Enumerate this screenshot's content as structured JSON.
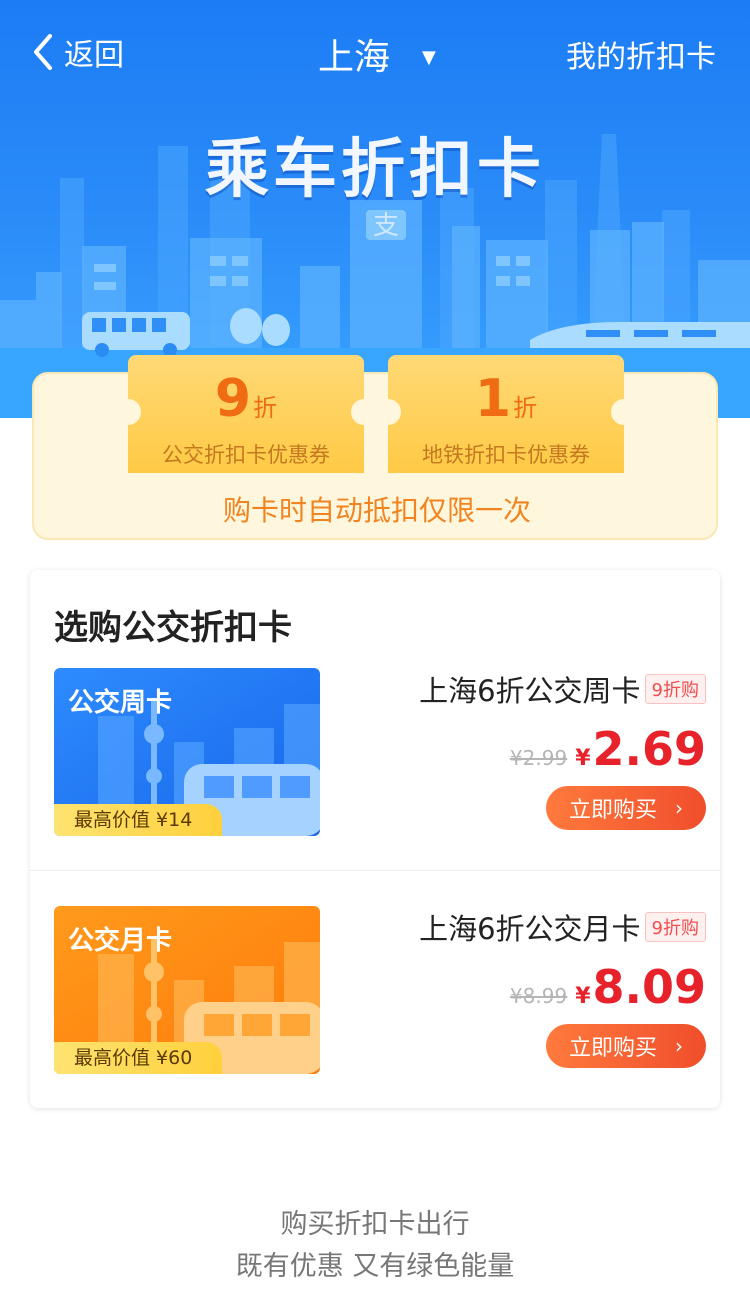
{
  "nav": {
    "back_label": "返回",
    "city": "上海",
    "my_cards": "我的折扣卡"
  },
  "banner": {
    "title": "乘车折扣卡",
    "logo_char": "支"
  },
  "coupons": [
    {
      "value": "9",
      "unit": "折",
      "label": "公交折扣卡优惠券"
    },
    {
      "value": "1",
      "unit": "折",
      "label": "地铁折扣卡优惠券"
    }
  ],
  "coupon_note": "购卡时自动抵扣仅限一次",
  "shop": {
    "title": "选购公交折扣卡",
    "products": [
      {
        "card_name": "公交周卡",
        "max_value": "最高价值 ¥14",
        "title": "上海6折公交周卡",
        "tag": "9折购",
        "old_price": "¥2.99",
        "currency": "¥",
        "price": "2.69",
        "buy_label": "立即购买",
        "theme": "#2b82f5"
      },
      {
        "card_name": "公交月卡",
        "max_value": "最高价值 ¥60",
        "title": "上海6折公交月卡",
        "tag": "9折购",
        "old_price": "¥8.99",
        "currency": "¥",
        "price": "8.09",
        "buy_label": "立即购买",
        "theme": "#ff9012"
      }
    ]
  },
  "footer": {
    "line1": "购买折扣卡出行",
    "line2": "既有优惠 又有绿色能量"
  },
  "colors": {
    "brand_blue": "#1c7cf5",
    "price_red": "#e8222b",
    "coupon_orange": "#ef6c12"
  }
}
